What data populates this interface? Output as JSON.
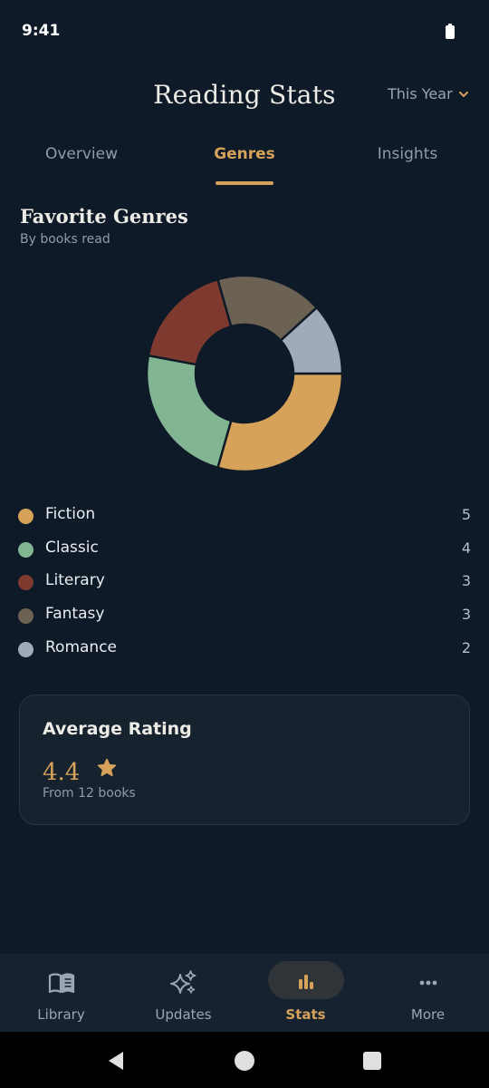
{
  "status_bar": {
    "time": "9:41"
  },
  "header": {
    "title": "Reading Stats",
    "period": "This Year"
  },
  "tabs": [
    {
      "label": "Overview",
      "active": false
    },
    {
      "label": "Genres",
      "active": true
    },
    {
      "label": "Insights",
      "active": false
    }
  ],
  "genres_section": {
    "title": "Favorite Genres",
    "subtitle": "By books read"
  },
  "chart_data": {
    "type": "pie",
    "categories": [
      "Fiction",
      "Classic",
      "Literary",
      "Fantasy",
      "Romance"
    ],
    "values": [
      5,
      4,
      3,
      3,
      2
    ],
    "colors": [
      "#d6a25a",
      "#82b692",
      "#7f3a30",
      "#6c6253",
      "#a0aab9"
    ],
    "donut": true
  },
  "legend": [
    {
      "label": "Fiction",
      "value": "5",
      "color": "#d6a25a"
    },
    {
      "label": "Classic",
      "value": "4",
      "color": "#82b692"
    },
    {
      "label": "Literary",
      "value": "3",
      "color": "#7f3a30"
    },
    {
      "label": "Fantasy",
      "value": "3",
      "color": "#6c6253"
    },
    {
      "label": "Romance",
      "value": "2",
      "color": "#a0aab9"
    }
  ],
  "rating_card": {
    "title": "Average Rating",
    "value": "4.4",
    "caption": "From 12 books",
    "star_icon": "star-icon"
  },
  "bottom_nav": [
    {
      "label": "Library",
      "icon": "book-icon",
      "active": false
    },
    {
      "label": "Updates",
      "icon": "sparkle-icon",
      "active": false
    },
    {
      "label": "Stats",
      "icon": "bar-chart-icon",
      "active": true
    },
    {
      "label": "More",
      "icon": "more-icon",
      "active": false
    }
  ],
  "system_nav": {
    "back_icon": "back-icon",
    "home_icon": "home-icon",
    "recents_icon": "recents-icon"
  },
  "colors": {
    "background": "#0f1a28",
    "accent": "#d6a25a",
    "card": "#17222f",
    "nav": "#172231"
  }
}
